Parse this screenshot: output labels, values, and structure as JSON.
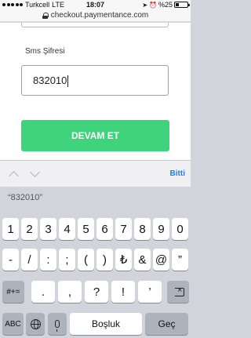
{
  "status_bar": {
    "carrier": "Turkcell",
    "network": "LTE",
    "time": "18:07",
    "battery": "%25"
  },
  "browser": {
    "url": "checkout.paymentance.com"
  },
  "form": {
    "sms_label": "Sms Şifresi",
    "sms_value": "832010",
    "submit_label": "DEVAM ET"
  },
  "accessory": {
    "done_label": "Bitti"
  },
  "suggestion": {
    "text": "“832010”"
  },
  "keyboard": {
    "row1": [
      "1",
      "2",
      "3",
      "4",
      "5",
      "6",
      "7",
      "8",
      "9",
      "0"
    ],
    "row2": [
      "-",
      "/",
      ":",
      ";",
      "(",
      ")",
      "₺",
      "&",
      "@",
      "”"
    ],
    "row3_mode": "#+=",
    "row3": [
      ".",
      ",",
      "?",
      "!",
      "’"
    ],
    "row4_abc": "ABC",
    "space_label": "Boşluk",
    "return_label": "Geç"
  }
}
